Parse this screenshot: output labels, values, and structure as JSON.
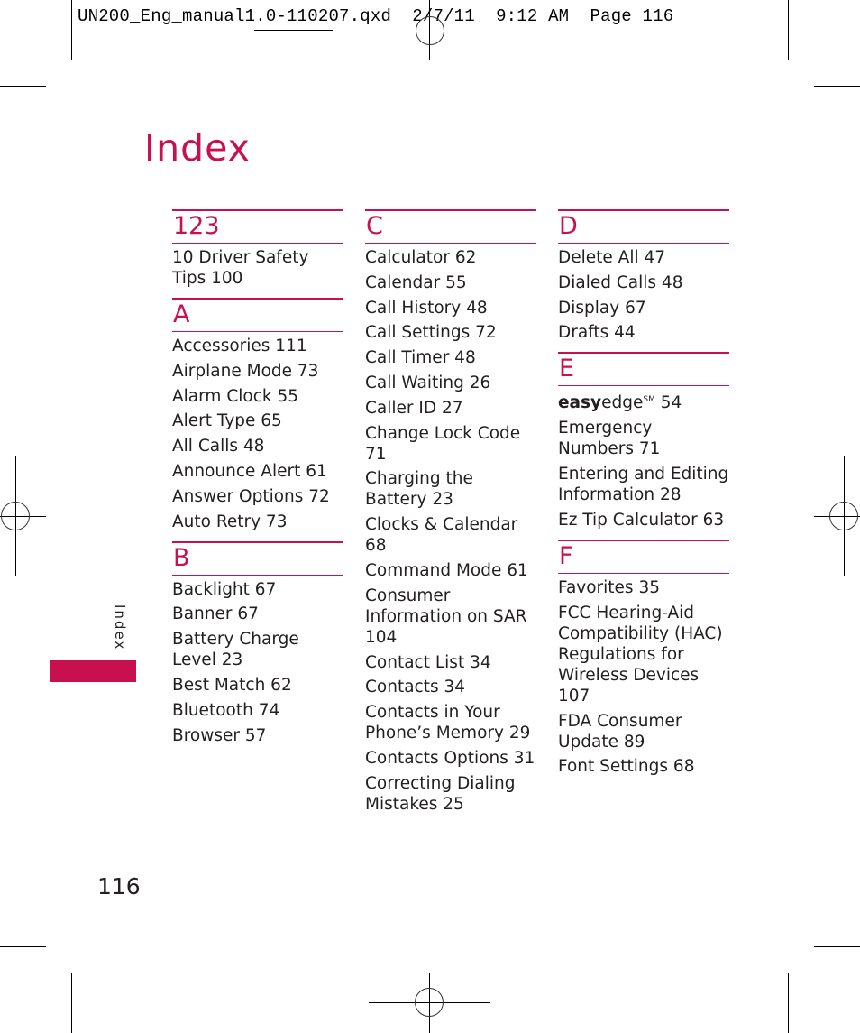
{
  "slug_line": "UN200_Eng_manual1.0-110207.qxd  2/7/11  9:12 AM  Page 116",
  "title": "Index",
  "side_tab": "Index",
  "page_number": "116",
  "accent_color": "#c8104e",
  "columns": [
    [
      {
        "letter": "123",
        "entries": [
          "10 Driver Safety Tips 100"
        ]
      },
      {
        "letter": "A",
        "entries": [
          "Accessories 111",
          "Airplane Mode 73",
          "Alarm Clock 55",
          "Alert Type 65",
          "All Calls 48",
          "Announce Alert 61",
          "Answer Options 72",
          "Auto Retry 73"
        ]
      },
      {
        "letter": "B",
        "entries": [
          "Backlight 67",
          "Banner 67",
          "Battery Charge Level 23",
          "Best Match 62",
          "Bluetooth 74",
          "Browser 57"
        ]
      }
    ],
    [
      {
        "letter": "C",
        "entries": [
          "Calculator 62",
          "Calendar 55",
          "Call History 48",
          "Call Settings 72",
          "Call Timer 48",
          "Call Waiting 26",
          "Caller ID 27",
          "Change Lock Code 71",
          "Charging the Battery 23",
          "Clocks & Calendar 68",
          "Command Mode 61",
          "Consumer Information on SAR 104",
          "Contact List 34",
          "Contacts 34",
          "Contacts in Your Phone’s Memory 29",
          "Contacts Options 31",
          "Correcting Dialing Mistakes 25"
        ]
      }
    ],
    [
      {
        "letter": "D",
        "entries": [
          "Delete All 47",
          "Dialed Calls 48",
          "Display 67",
          "Drafts 44"
        ]
      },
      {
        "letter": "E",
        "entries": [
          "easyedge℠ 54",
          "Emergency Numbers 71",
          "Entering and Editing Information 28",
          "Ez Tip Calculator 63"
        ]
      },
      {
        "letter": "F",
        "entries": [
          "Favorites 35",
          "FCC Hearing-Aid Compatibility (HAC) Regulations for Wireless Devices 107",
          "FDA Consumer Update 89",
          "Font Settings 68"
        ]
      }
    ]
  ]
}
